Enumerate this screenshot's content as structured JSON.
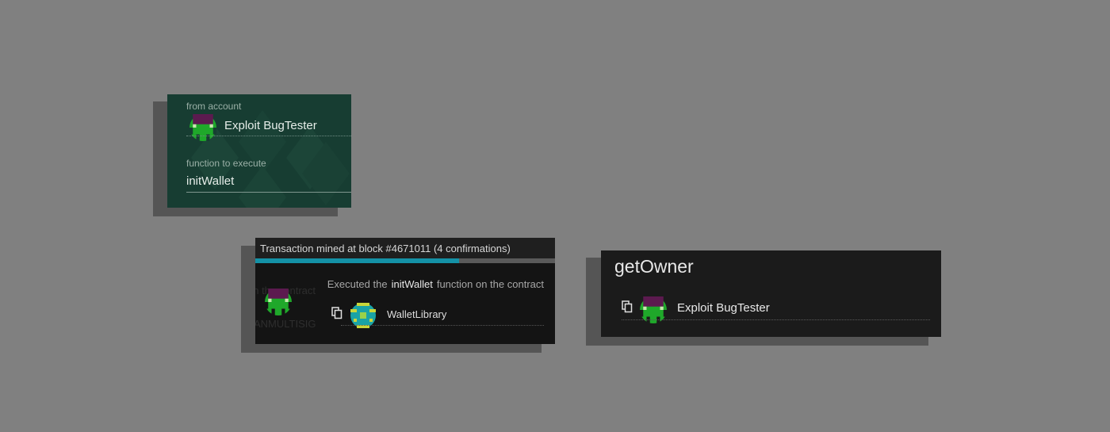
{
  "send_form": {
    "from_label": "from account",
    "from_account": "Exploit BugTester",
    "function_label": "function to execute",
    "function_value": "initWallet",
    "cut_off_label": "…"
  },
  "notification": {
    "header": "Transaction mined at block #4671011 (4 confirmations)",
    "progress_percent": 68,
    "executed_prefix": "Executed the",
    "function_name": "initWallet",
    "executed_suffix": "function on the contract",
    "contract_name": "WalletLibrary",
    "bg_text_1": "on the contract",
    "bg_text_2": "ANMULTISIG"
  },
  "get_owner": {
    "title": "getOwner",
    "owner_name": "Exploit BugTester"
  },
  "colors": {
    "background": "#808080",
    "green_panel": "#173d32",
    "dark_panel": "#141414",
    "accent": "#1491a6"
  },
  "icons": {
    "account": "identicon-icon",
    "contract": "identicon-icon",
    "copy": "copy-icon"
  }
}
